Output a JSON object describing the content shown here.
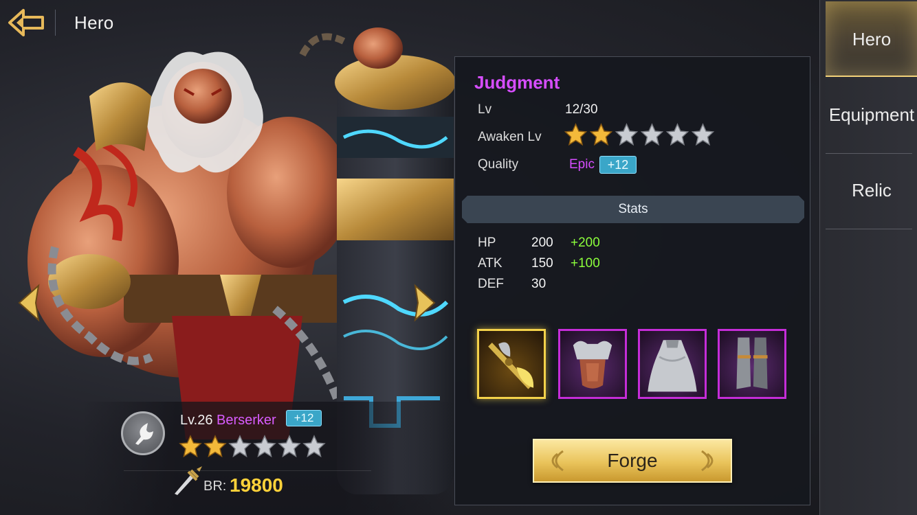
{
  "header": {
    "title": "Hero"
  },
  "hero": {
    "level_text": "Lv.26",
    "class_name": "Berserker",
    "plus": "+12",
    "stars_filled": 2,
    "stars_total": 6,
    "br_label": "BR:",
    "br_value": "19800"
  },
  "weapon": {
    "name": "Judgment",
    "lv_label": "Lv",
    "lv_value": "12/30",
    "awaken_label": "Awaken Lv",
    "awaken_filled": 2,
    "awaken_total": 6,
    "quality_label": "Quality",
    "quality_value": "Epic",
    "quality_plus": "+12"
  },
  "stats": {
    "title": "Stats",
    "rows": [
      {
        "name": "HP",
        "value": "200",
        "bonus": "+200"
      },
      {
        "name": "ATK",
        "value": "150",
        "bonus": "+100"
      },
      {
        "name": "DEF",
        "value": "30",
        "bonus": ""
      }
    ]
  },
  "equipment_slots": [
    {
      "icon": "weapon-axe-icon",
      "rarity": "legendary"
    },
    {
      "icon": "chest-armor-icon",
      "rarity": "epic"
    },
    {
      "icon": "cloak-icon",
      "rarity": "epic"
    },
    {
      "icon": "greaves-icon",
      "rarity": "epic"
    }
  ],
  "forge_button": {
    "label": "Forge"
  },
  "tabs": [
    {
      "label": "Hero",
      "active": true
    },
    {
      "label": "Equipment",
      "active": false
    },
    {
      "label": "Relic",
      "active": false
    }
  ],
  "colors": {
    "epic": "#d64dff",
    "bonus": "#8cff3c",
    "br": "#ffd23a",
    "star_filled": "#f3b93a",
    "star_empty": "#c9ccd2"
  }
}
